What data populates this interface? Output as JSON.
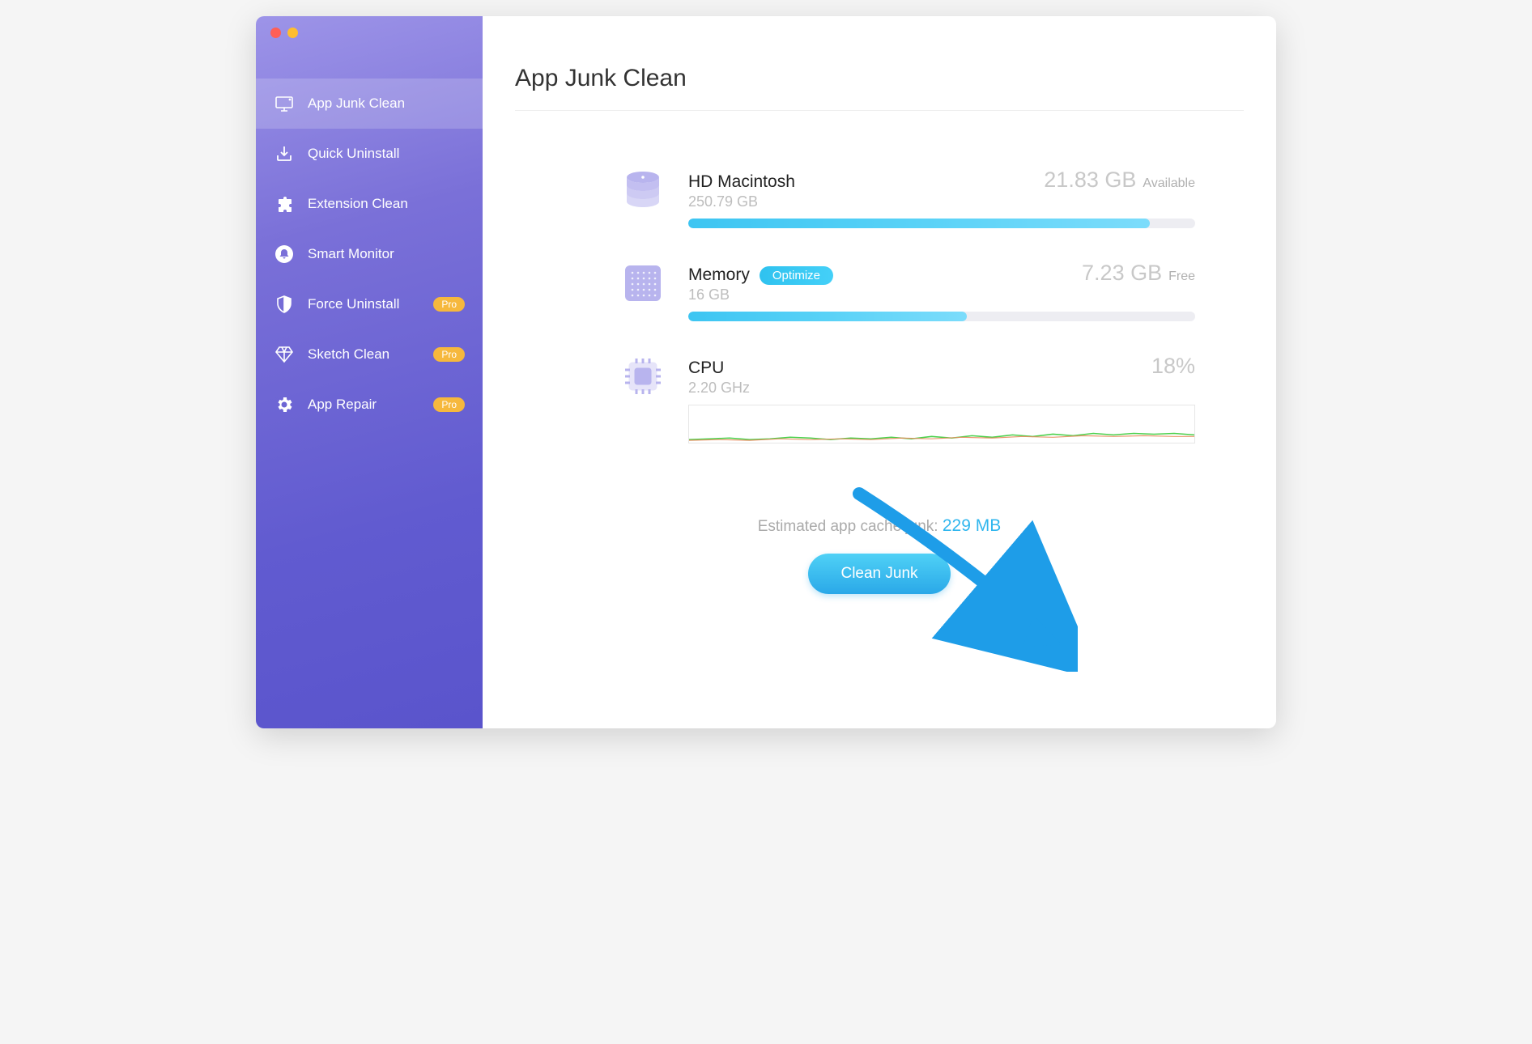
{
  "page_title": "App Junk Clean",
  "sidebar": {
    "items": [
      {
        "label": "App Junk Clean",
        "pro": false,
        "active": true
      },
      {
        "label": "Quick Uninstall",
        "pro": false,
        "active": false
      },
      {
        "label": "Extension Clean",
        "pro": false,
        "active": false
      },
      {
        "label": "Smart Monitor",
        "pro": false,
        "active": false
      },
      {
        "label": "Force Uninstall",
        "pro": true,
        "active": false
      },
      {
        "label": "Sketch Clean",
        "pro": true,
        "active": false
      },
      {
        "label": "App Repair",
        "pro": true,
        "active": false
      }
    ],
    "pro_label": "Pro"
  },
  "disk": {
    "title": "HD Macintosh",
    "total": "250.79 GB",
    "available_value": "21.83 GB",
    "available_label": "Available",
    "used_percent": 91
  },
  "memory": {
    "title": "Memory",
    "optimize_label": "Optimize",
    "total": "16 GB",
    "free_value": "7.23 GB",
    "free_label": "Free",
    "used_percent": 55
  },
  "cpu": {
    "title": "CPU",
    "freq": "2.20 GHz",
    "usage": "18%"
  },
  "estimate": {
    "label": "Estimated app cache junk:",
    "value": "229 MB"
  },
  "clean_button": "Clean Junk",
  "colors": {
    "sidebar_top": "#9d94e8",
    "sidebar_bottom": "#5a54cc",
    "accent_blue": "#2fb6ee",
    "pro_badge": "#f6b83d"
  }
}
